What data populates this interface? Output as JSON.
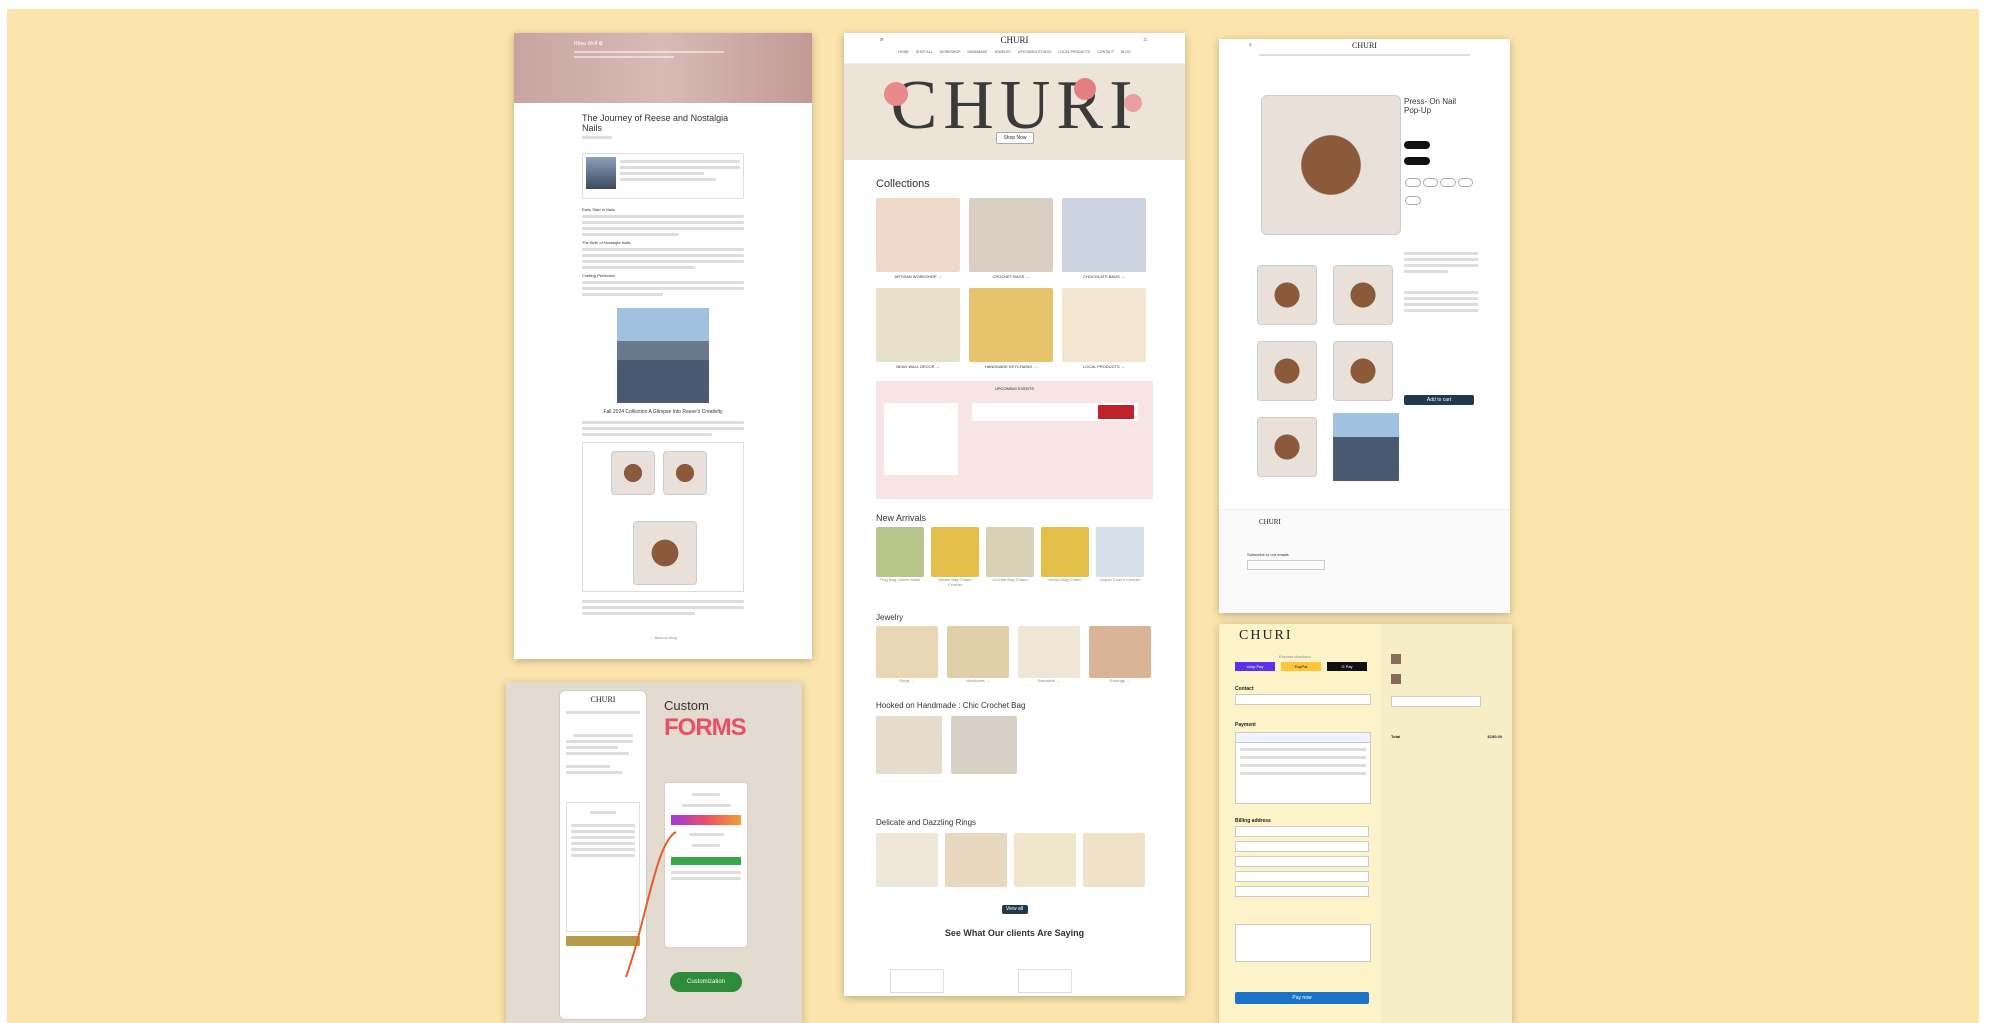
{
  "blog": {
    "author": "Rhea Wolf ✿",
    "title": "The Journey of Reese and Nostalgia Nails",
    "read_more": "← Back to blog",
    "caption": "Fall 2024 Collection A Glimpse Into Reese's Creativity",
    "sections": [
      "Early Start in Nails",
      "The Birth of Nostalgia Nails",
      "Crafting Perfection"
    ]
  },
  "home": {
    "brand": "CHURI",
    "nav": [
      "HOME",
      "SHOP ALL",
      "WORKSHOP",
      "HANDMADE",
      "JEWELRY",
      "UPCOMING STUDIO",
      "LOCAL PRODUCTS",
      "CONTACT",
      "BLOG"
    ],
    "hero_button": "Shop Now",
    "collections_title": "Collections",
    "collections": [
      "ARTISAN WORKSHOP →",
      "CROCHET BAGS →",
      "CHOCOLATE BAGS →",
      "BEAD WALL DECOR →",
      "HANDMADE KEYCHAINS →",
      "LOCAL PRODUCTS →"
    ],
    "events_title": "UPCOMING EVENTS",
    "new_arrivals_title": "New Arrivals",
    "new_arrivals": [
      "Frog Bag Charm Slider",
      "Minion Bag Charm Crochet",
      "Crochet Bag Charm",
      "Minion Bag Charm",
      "Airpod Charm Crochet"
    ],
    "jewelry_title": "Jewelry",
    "jewelry": [
      "Rings →",
      "Necklaces →",
      "Bracelets →",
      "Earrings →"
    ],
    "hooked_title": "Hooked on Handmade : Chic Crochet Bag",
    "rings_title": "Delicate and Dazzling Rings",
    "rings_button": "View all",
    "reviews_title": "See What Our clients Are Saying"
  },
  "product": {
    "brand": "CHURI",
    "title": "Press- On Nail Pop-Up",
    "button": "Add to cart",
    "footer_brand": "CHURI",
    "subscribe": "Subscribe to our emails"
  },
  "forms": {
    "brand": "CHURI",
    "heading_1": "Custom",
    "heading_2": "FORMS",
    "badge": "Customization"
  },
  "checkout": {
    "brand": "CHURI",
    "express_label": "Express checkout",
    "express": [
      "shop Pay",
      "PayPal",
      "G Pay"
    ],
    "contact": "Contact",
    "payment": "Payment",
    "billing": "Billing address",
    "pay_button": "Pay now",
    "total_label": "Total",
    "total": "$150.00"
  },
  "colors": {
    "canvas": "#fbe5ad",
    "navy": "#1f3a4d",
    "rose": "#ea4f6a",
    "cream": "#fdf3c8"
  }
}
